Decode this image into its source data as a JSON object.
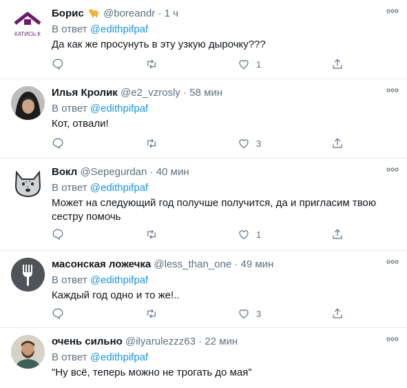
{
  "reply_prefix": "В ответ",
  "colors": {
    "accent": "#1b95e0",
    "muted": "#5b7083",
    "text": "#0f1419",
    "divider": "#e6ecf0"
  },
  "tweets": [
    {
      "name": "Борис",
      "has_emoji": true,
      "emoji_icon": "dog-icon",
      "handle": "@boreandr",
      "time": "1 ч",
      "reply_to": "@edithpifpaf",
      "text": "Да как же просунуть в эту узкую дырочку???",
      "likes": "1",
      "avatar": {
        "icon": "roof-logo-avatar",
        "caption": "КАТИСЬ К"
      }
    },
    {
      "name": "Илья Кролик",
      "has_emoji": false,
      "handle": "@e2_vzrosly",
      "time": "58 мин",
      "reply_to": "@edithpifpaf",
      "text": "Кот, отвали!",
      "likes": "3",
      "avatar": {
        "icon": "hooded-person-avatar"
      }
    },
    {
      "name": "Вокл",
      "has_emoji": false,
      "handle": "@Sepegurdan",
      "time": "40 мин",
      "reply_to": "@edithpifpaf",
      "text": "Может на следующий год получше получится, да и пригласим твою сестру помочь",
      "likes": "1",
      "avatar": {
        "icon": "wolf-avatar"
      }
    },
    {
      "name": "масонская ложечка",
      "has_emoji": false,
      "handle": "@less_than_one",
      "time": "49 мин",
      "reply_to": "@edithpifpaf",
      "text": "Каждый год одно и то же!..",
      "likes": "3",
      "avatar": {
        "icon": "fork-avatar"
      }
    },
    {
      "name": "очень сильно",
      "has_emoji": false,
      "handle": "@ilyarulezzz63",
      "time": "22 мин",
      "reply_to": "@edithpifpaf",
      "text": "\"Ну всё, теперь можно не трогать до мая\"",
      "likes": "",
      "avatar": {
        "icon": "bearded-man-avatar"
      }
    }
  ]
}
